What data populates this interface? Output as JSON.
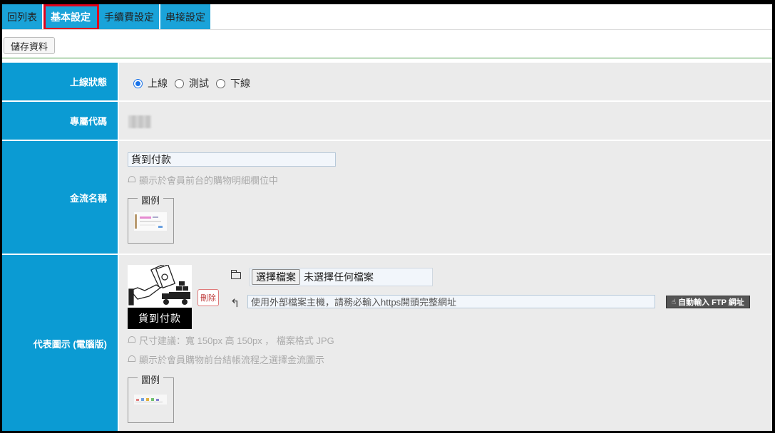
{
  "tabs": [
    {
      "label": "回列表"
    },
    {
      "label": "基本設定"
    },
    {
      "label": "手續費設定"
    },
    {
      "label": "串接設定"
    }
  ],
  "toolbar": {
    "save_label": "儲存資料"
  },
  "rows": {
    "status": {
      "label": "上線狀態",
      "options": [
        "上線",
        "測試",
        "下線"
      ],
      "selected": "上線"
    },
    "code": {
      "label": "專屬代碼"
    },
    "name": {
      "label": "金流名稱",
      "value": "貨到付款",
      "hint": "顯示於會員前台的購物明細欄位中",
      "example_title": "圖例"
    },
    "image": {
      "label": "代表圖示 (電腦版)",
      "caption": "貨到付款",
      "delete_label": "刪除",
      "file_button": "選擇檔案",
      "file_status": "未選擇任何檔案",
      "url_placeholder": "使用外部檔案主機，請務必輸入https開頭完整網址",
      "ftp_button": "自動輸入 FTP 網址",
      "hint_size": "尺寸建議：寬 150px 高 150px ， 檔案格式 JPG",
      "hint_display": "顯示於會員購物前台結帳流程之選擇金流圖示",
      "example_title": "圖例"
    }
  },
  "colors": {
    "tab": "#1aa3d9",
    "label": "#0b9bd3",
    "active_outline": "#e0001b"
  }
}
